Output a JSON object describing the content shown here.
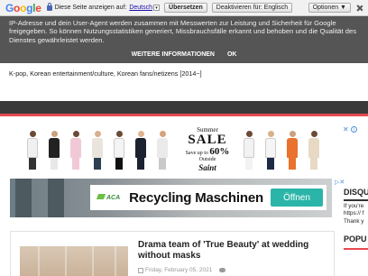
{
  "translate_bar": {
    "logo": "Google",
    "prompt": "Diese Seite anzeigen auf:",
    "language": "Deutsch",
    "translate_button": "Übersetzen",
    "deactivate_button": "Deaktivieren für: Englisch",
    "options_button": "Optionen ▼"
  },
  "cookie_notice": {
    "text": "IP-Adresse und dein User-Agent werden zusammen mit Messwerten zur Leistung und Sicherheit für Google freigegeben. So können Nutzungsstatistiken generiert, Missbrauchsfälle erkannt und behoben und die Qualität des Dienstes gewährleistet werden.",
    "more_info": "WEITERE INFORMATIONEN",
    "ok": "OK"
  },
  "blog": {
    "tagline": "K-pop, Korean entertainment/culture, Korean fans/netizens [2014~]"
  },
  "ad_fashion": {
    "line1": "Summer",
    "line2": "SALE",
    "line3_prefix": "Save up to",
    "line3_percent": "60%",
    "line3_suffix": "Outside",
    "brand": "Saint"
  },
  "ad_recycling": {
    "brand": "ACA",
    "title": "Recycling Maschinen",
    "cta": "Öffnen"
  },
  "sidebar": {
    "disqus_heading": "DISQUS",
    "disqus_lines": [
      "If you're",
      "https:// f",
      "Thank y"
    ],
    "popular_heading": "POPU"
  },
  "post": {
    "title": "Drama team of 'True Beauty' at wedding without masks",
    "date": "Friday, February 05, 2021"
  },
  "colors": {
    "nav_dark": "#3a3a3a",
    "accent_red": "#e8484f",
    "cta_teal": "#2bb5a8"
  }
}
